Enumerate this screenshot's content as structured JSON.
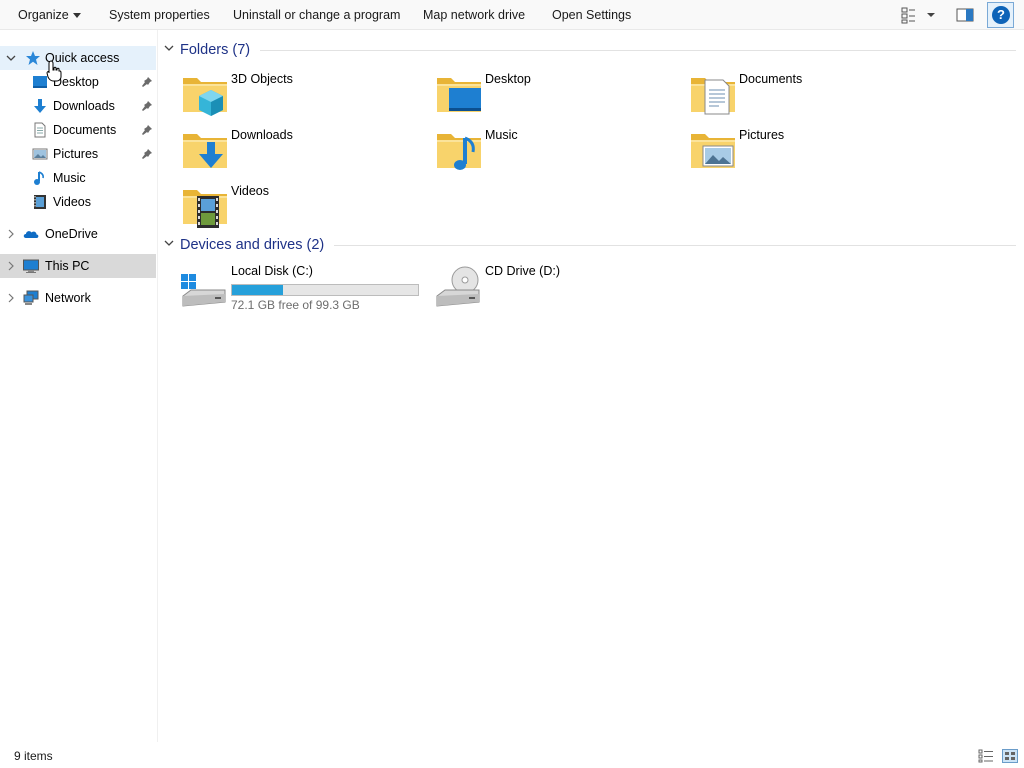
{
  "toolbar": {
    "organize": "Organize",
    "system_properties": "System properties",
    "uninstall": "Uninstall or change a program",
    "map_drive": "Map network drive",
    "open_settings": "Open Settings",
    "help": "?"
  },
  "nav": {
    "quick_access": "Quick access",
    "items": [
      {
        "label": "Desktop",
        "icon": "desktop-icon",
        "pinned": true
      },
      {
        "label": "Downloads",
        "icon": "downloads-icon",
        "pinned": true
      },
      {
        "label": "Documents",
        "icon": "documents-icon",
        "pinned": true
      },
      {
        "label": "Pictures",
        "icon": "pictures-icon",
        "pinned": true
      },
      {
        "label": "Music",
        "icon": "music-icon",
        "pinned": false
      },
      {
        "label": "Videos",
        "icon": "videos-icon",
        "pinned": false
      }
    ],
    "onedrive": "OneDrive",
    "this_pc": "This PC",
    "network": "Network"
  },
  "folders": {
    "header": "Folders (7)",
    "items": [
      {
        "label": "3D Objects",
        "icon": "3d-objects-folder-icon"
      },
      {
        "label": "Desktop",
        "icon": "desktop-folder-icon"
      },
      {
        "label": "Documents",
        "icon": "documents-folder-icon"
      },
      {
        "label": "Downloads",
        "icon": "downloads-folder-icon"
      },
      {
        "label": "Music",
        "icon": "music-folder-icon"
      },
      {
        "label": "Pictures",
        "icon": "pictures-folder-icon"
      },
      {
        "label": "Videos",
        "icon": "videos-folder-icon"
      }
    ]
  },
  "drives": {
    "header": "Devices and drives (2)",
    "items": [
      {
        "label": "Local Disk (C:)",
        "icon": "local-disk-icon",
        "free_text": "72.1 GB free of 99.3 GB",
        "used_fraction": 0.274
      },
      {
        "label": "CD Drive (D:)",
        "icon": "cd-drive-icon"
      }
    ]
  },
  "status": {
    "item_count": "9 items"
  },
  "colors": {
    "accent": "#26a0da",
    "group_header": "#1e3287",
    "folder_yellow": "#f6c445",
    "selection": "#d9d9d9",
    "hover": "#e5f1fb"
  }
}
